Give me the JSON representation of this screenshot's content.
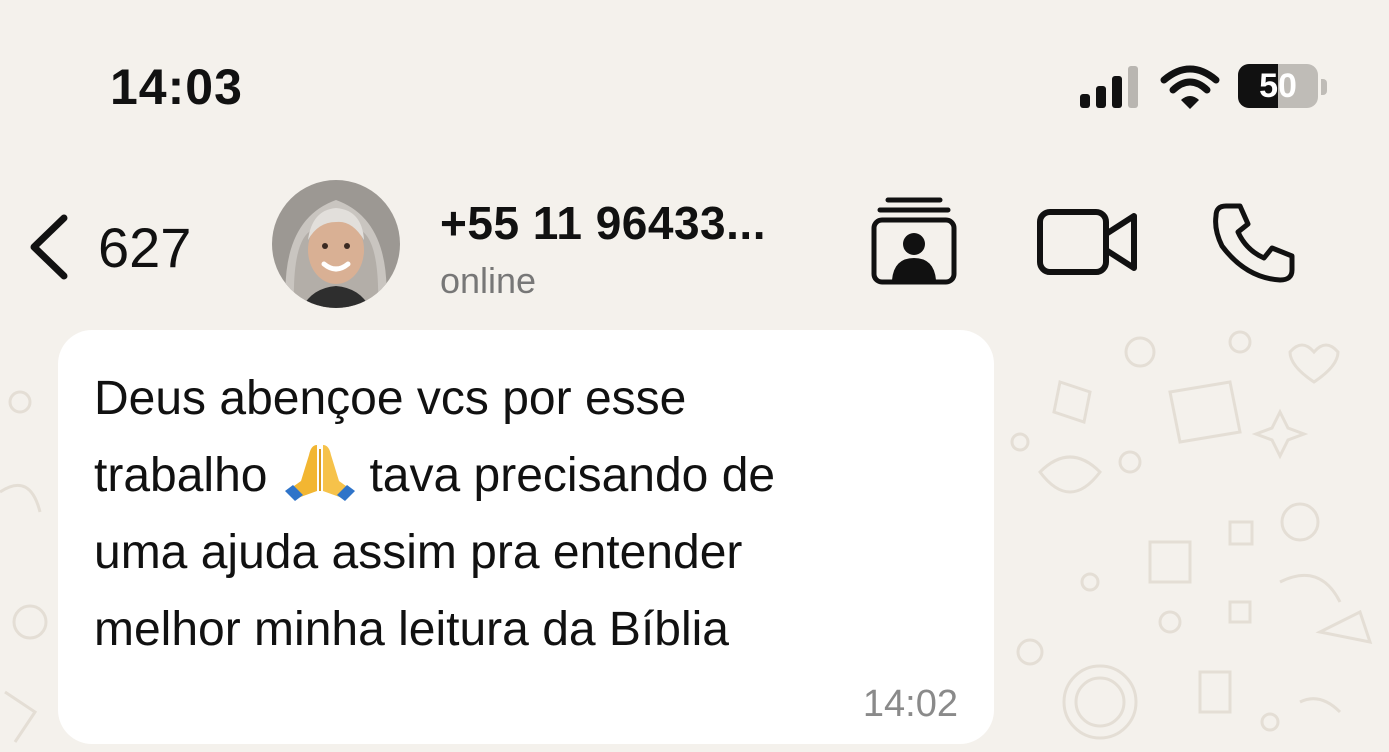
{
  "status_bar": {
    "time": "14:03",
    "battery_level": "50",
    "battery_fraction": 0.5
  },
  "header": {
    "back_count": "627",
    "contact_name": "+55 11 96433...",
    "contact_status": "online"
  },
  "message": {
    "lines": [
      "Deus abençoe vcs por esse",
      "trabalho",
      "tava precisando de",
      "uma ajuda assim pra entender",
      "melhor minha leitura da Bíblia"
    ],
    "emoji": "folded-hands",
    "time": "14:02"
  },
  "icons": {
    "signal": "signal-bars-icon",
    "wifi": "wifi-icon",
    "back": "chevron-left-icon",
    "contact_card": "contact-card-icon",
    "video": "video-camera-icon",
    "phone": "phone-icon"
  },
  "colors": {
    "background": "#f4f1ec",
    "bubble": "#ffffff",
    "secondary_text": "#8a8a8a"
  }
}
